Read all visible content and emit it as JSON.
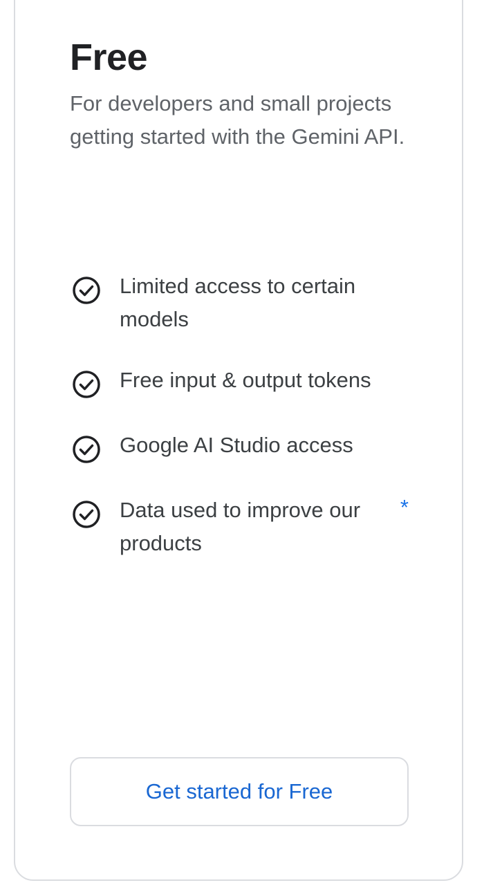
{
  "plan": {
    "title": "Free",
    "description": "For developers and small projects getting started with the Gemini API."
  },
  "features": [
    {
      "label": "Limited access to certain models",
      "icon": "check-circle-icon"
    },
    {
      "label": "Free input & output tokens",
      "icon": "check-circle-icon"
    },
    {
      "label": "Google AI Studio access",
      "icon": "check-circle-icon"
    },
    {
      "label": "Data used to improve our products",
      "icon": "check-circle-icon",
      "footnote": "*"
    }
  ],
  "cta": {
    "label": "Get started for Free"
  },
  "colors": {
    "accent": "#1a73e8",
    "title": "#202124",
    "body": "#5f6368",
    "feature_text": "#3c4043",
    "border": "#dadce0"
  }
}
